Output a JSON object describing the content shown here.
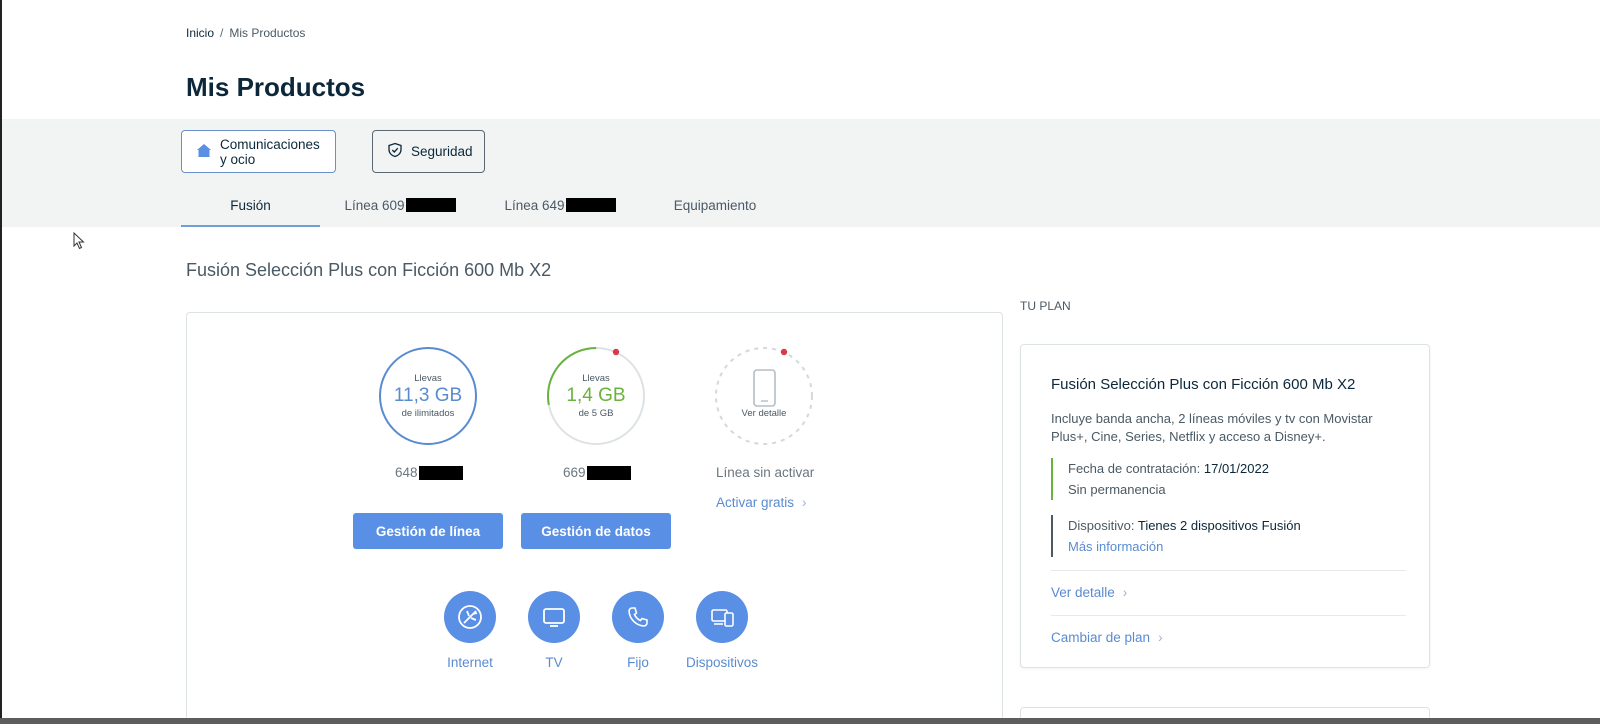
{
  "breadcrumb": {
    "home": "Inicio",
    "separator": "/",
    "current": "Mis Productos"
  },
  "page_title": "Mis Productos",
  "categories": [
    {
      "label": "Comunicaciones y ocio",
      "icon": "house-icon",
      "active": true
    },
    {
      "label": "Seguridad",
      "icon": "shield-icon",
      "active": false
    }
  ],
  "tabs": [
    {
      "label": "Fusión",
      "active": true
    },
    {
      "label": "Línea 609",
      "redacted": true
    },
    {
      "label": "Línea 649",
      "redacted": true
    },
    {
      "label": "Equipamiento"
    }
  ],
  "product_title": "Fusión Selección Plus con Ficción 600 Mb X2",
  "lines": [
    {
      "top": "Llevas",
      "value": "11,3 GB",
      "bottom": "de ilimitados",
      "number": "648",
      "color": "#5a8bd0",
      "fraction": 1.0
    },
    {
      "top": "Llevas",
      "value": "1,4 GB",
      "bottom": "de 5 GB",
      "number": "669",
      "color": "#6ab23f",
      "fraction": 0.28
    },
    {
      "detail": "Ver detalle",
      "status": "Línea sin activar",
      "activate_link": "Activar gratis"
    }
  ],
  "buttons": {
    "line_management": "Gestión de línea",
    "data_management": "Gestión de datos"
  },
  "services": [
    {
      "label": "Internet",
      "icon": "internet-icon"
    },
    {
      "label": "TV",
      "icon": "tv-icon"
    },
    {
      "label": "Fijo",
      "icon": "phone-icon"
    },
    {
      "label": "Dispositivos",
      "icon": "devices-icon"
    }
  ],
  "plan": {
    "heading": "TU PLAN",
    "name": "Fusión Selección Plus con Ficción 600 Mb X2",
    "description": "Incluye banda ancha, 2 líneas móviles y tv con Movistar Plus+, Cine, Series, Netflix y acceso a Disney+.",
    "contract_label": "Fecha de contratación:",
    "contract_date": "17/01/2022",
    "permanence": "Sin permanencia",
    "device_label": "Dispositivo:",
    "device_value": "Tienes 2 dispositivos Fusión",
    "more_info": "Más información",
    "detail_link": "Ver detalle",
    "change_plan_link": "Cambiar de plan"
  },
  "colors": {
    "accent_blue": "#5a8fe6",
    "link_blue": "#5a8bd0",
    "green": "#6ab23f",
    "alert_red": "#d93a4a",
    "text_dark": "#0b2739",
    "band_gray": "#f2f4f4"
  }
}
